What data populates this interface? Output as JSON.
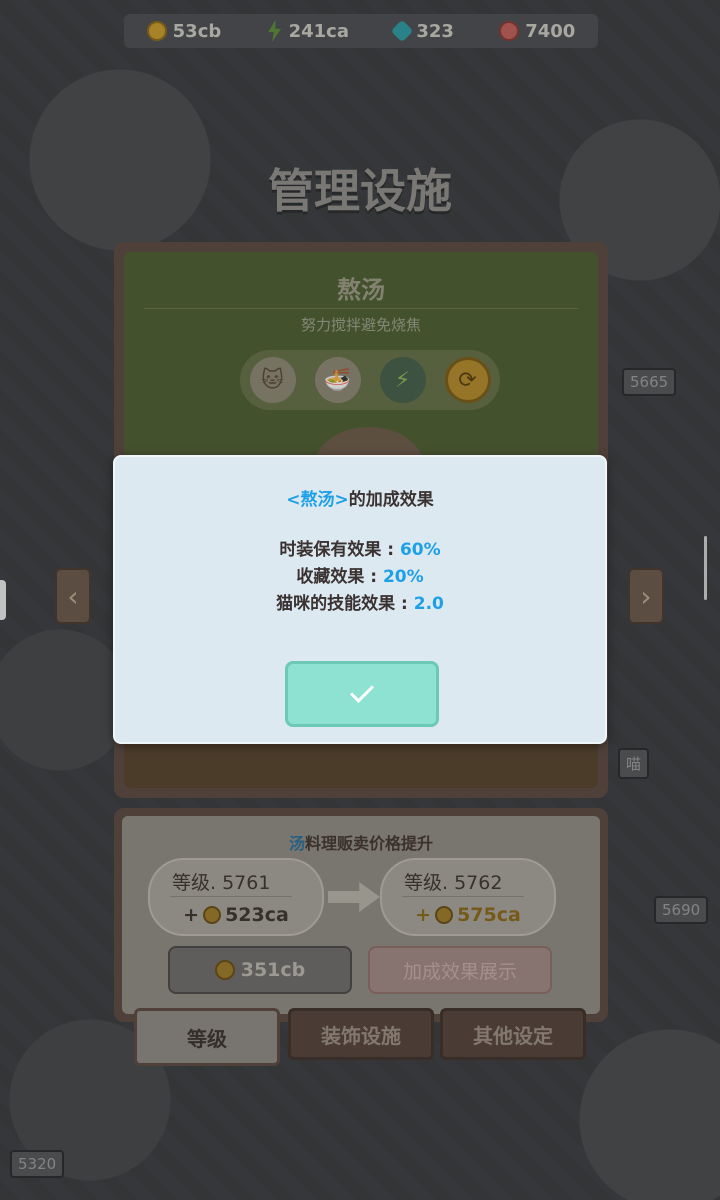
{
  "currencies": [
    {
      "icon": "coin-icon",
      "value": "53cb"
    },
    {
      "icon": "bolt-icon",
      "value": "241ca"
    },
    {
      "icon": "gem-icon",
      "value": "323"
    },
    {
      "icon": "ticket-icon",
      "value": "7400"
    }
  ],
  "page_title": "管理设施",
  "background_signs": [
    "5665",
    "5690",
    "5320",
    "喵"
  ],
  "facility": {
    "title": "熬汤",
    "description": "努力搅拌避免烧焦",
    "icons": [
      "cat-icon",
      "noodle-bowl-icon",
      "skill-bolt-icon",
      "refresh-icon"
    ]
  },
  "popup": {
    "title_highlight": "<熬汤>",
    "title_rest": "的加成效果",
    "stats": [
      {
        "label": "时装保有效果 : ",
        "value": "60%"
      },
      {
        "label": "收藏效果 : ",
        "value": "20%"
      },
      {
        "label": "猫咪的技能效果 : ",
        "value": "2.0"
      }
    ],
    "confirm_icon": "check-icon"
  },
  "upgrade": {
    "title_accent": "汤",
    "title_rest": "料理贩卖价格提升",
    "current_level": "等级. 5761",
    "current_value_prefix": "+",
    "current_value": "523ca",
    "next_level": "等级. 5762",
    "next_value_prefix": "+",
    "next_value": "575ca",
    "cost": "351cb",
    "bonus_button": "加成效果展示"
  },
  "tabs": [
    "等级",
    "装饰设施",
    "其他设定"
  ],
  "colors": {
    "highlight_blue": "#1ea0e8",
    "confirm_green": "#8ee2d2",
    "popup_bg": "#dce9f0"
  }
}
